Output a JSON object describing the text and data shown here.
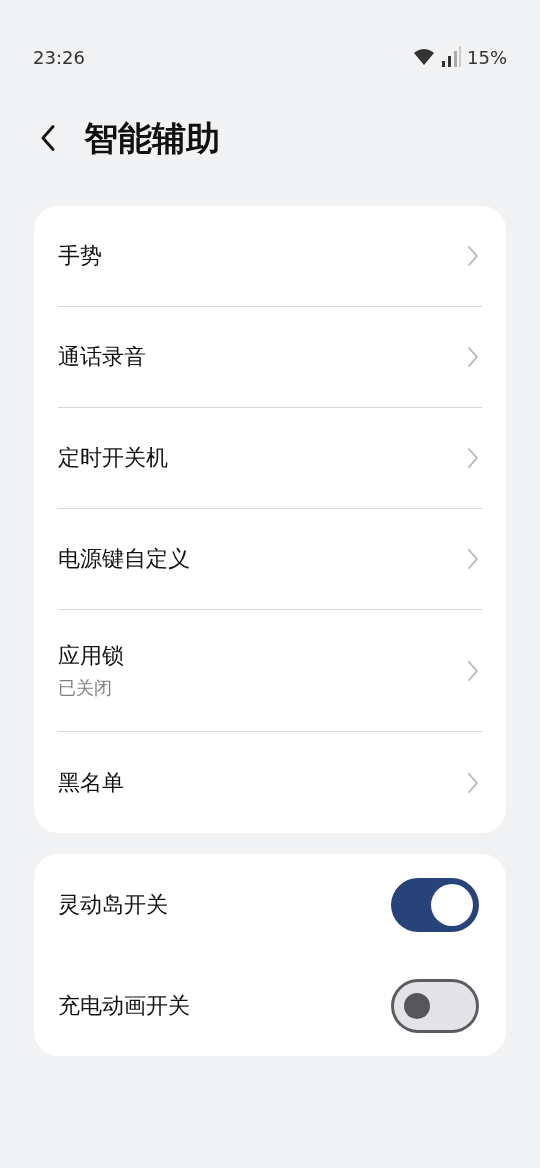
{
  "status_bar": {
    "time": "23:26",
    "battery": "15%"
  },
  "header": {
    "title": "智能辅助"
  },
  "groups": [
    {
      "items": [
        {
          "kind": "link",
          "label": "手势"
        },
        {
          "kind": "link",
          "label": "通话录音"
        },
        {
          "kind": "link",
          "label": "定时开关机"
        },
        {
          "kind": "link",
          "label": "电源键自定义"
        },
        {
          "kind": "link",
          "label": "应用锁",
          "subtitle": "已关闭"
        },
        {
          "kind": "link",
          "label": "黑名单"
        }
      ]
    },
    {
      "items": [
        {
          "kind": "switch",
          "label": "灵动岛开关",
          "on": true
        },
        {
          "kind": "switch",
          "label": "充电动画开关",
          "on": false
        }
      ]
    }
  ]
}
